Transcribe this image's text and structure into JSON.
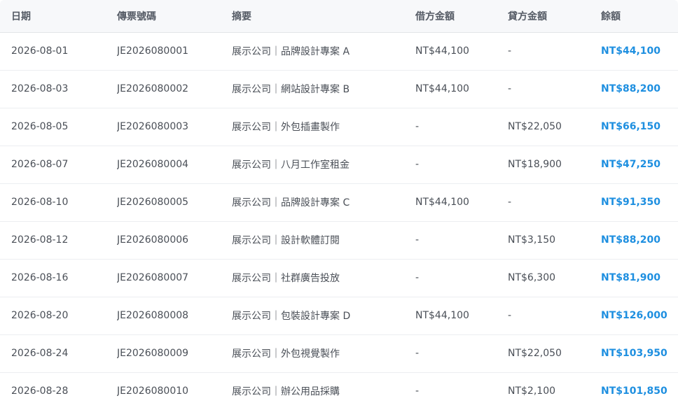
{
  "table": {
    "columns": [
      "日期",
      "傳票號碼",
      "摘要",
      "借方金額",
      "貸方金額",
      "餘額"
    ],
    "rows": [
      {
        "date": "2026-08-01",
        "voucher": "JE2026080001",
        "summary": "展示公司｜品牌設計專案 A",
        "debit": "NT$44,100",
        "credit": "-",
        "balance": "NT$44,100"
      },
      {
        "date": "2026-08-03",
        "voucher": "JE2026080002",
        "summary": "展示公司｜網站設計專案 B",
        "debit": "NT$44,100",
        "credit": "-",
        "balance": "NT$88,200"
      },
      {
        "date": "2026-08-05",
        "voucher": "JE2026080003",
        "summary": "展示公司｜外包插畫製作",
        "debit": "-",
        "credit": "NT$22,050",
        "balance": "NT$66,150"
      },
      {
        "date": "2026-08-07",
        "voucher": "JE2026080004",
        "summary": "展示公司｜八月工作室租金",
        "debit": "-",
        "credit": "NT$18,900",
        "balance": "NT$47,250"
      },
      {
        "date": "2026-08-10",
        "voucher": "JE2026080005",
        "summary": "展示公司｜品牌設計專案 C",
        "debit": "NT$44,100",
        "credit": "-",
        "balance": "NT$91,350"
      },
      {
        "date": "2026-08-12",
        "voucher": "JE2026080006",
        "summary": "展示公司｜設計軟體訂閱",
        "debit": "-",
        "credit": "NT$3,150",
        "balance": "NT$88,200"
      },
      {
        "date": "2026-08-16",
        "voucher": "JE2026080007",
        "summary": "展示公司｜社群廣告投放",
        "debit": "-",
        "credit": "NT$6,300",
        "balance": "NT$81,900"
      },
      {
        "date": "2026-08-20",
        "voucher": "JE2026080008",
        "summary": "展示公司｜包裝設計專案 D",
        "debit": "NT$44,100",
        "credit": "-",
        "balance": "NT$126,000"
      },
      {
        "date": "2026-08-24",
        "voucher": "JE2026080009",
        "summary": "展示公司｜外包視覺製作",
        "debit": "-",
        "credit": "NT$22,050",
        "balance": "NT$103,950"
      },
      {
        "date": "2026-08-28",
        "voucher": "JE2026080010",
        "summary": "展示公司｜辦公用品採購",
        "debit": "-",
        "credit": "NT$2,100",
        "balance": "NT$101,850"
      }
    ]
  },
  "colors": {
    "balance": "#1e8fe0",
    "header_bg": "#f7f8fa",
    "text": "#4a4f57",
    "divider": "#eceef1"
  }
}
